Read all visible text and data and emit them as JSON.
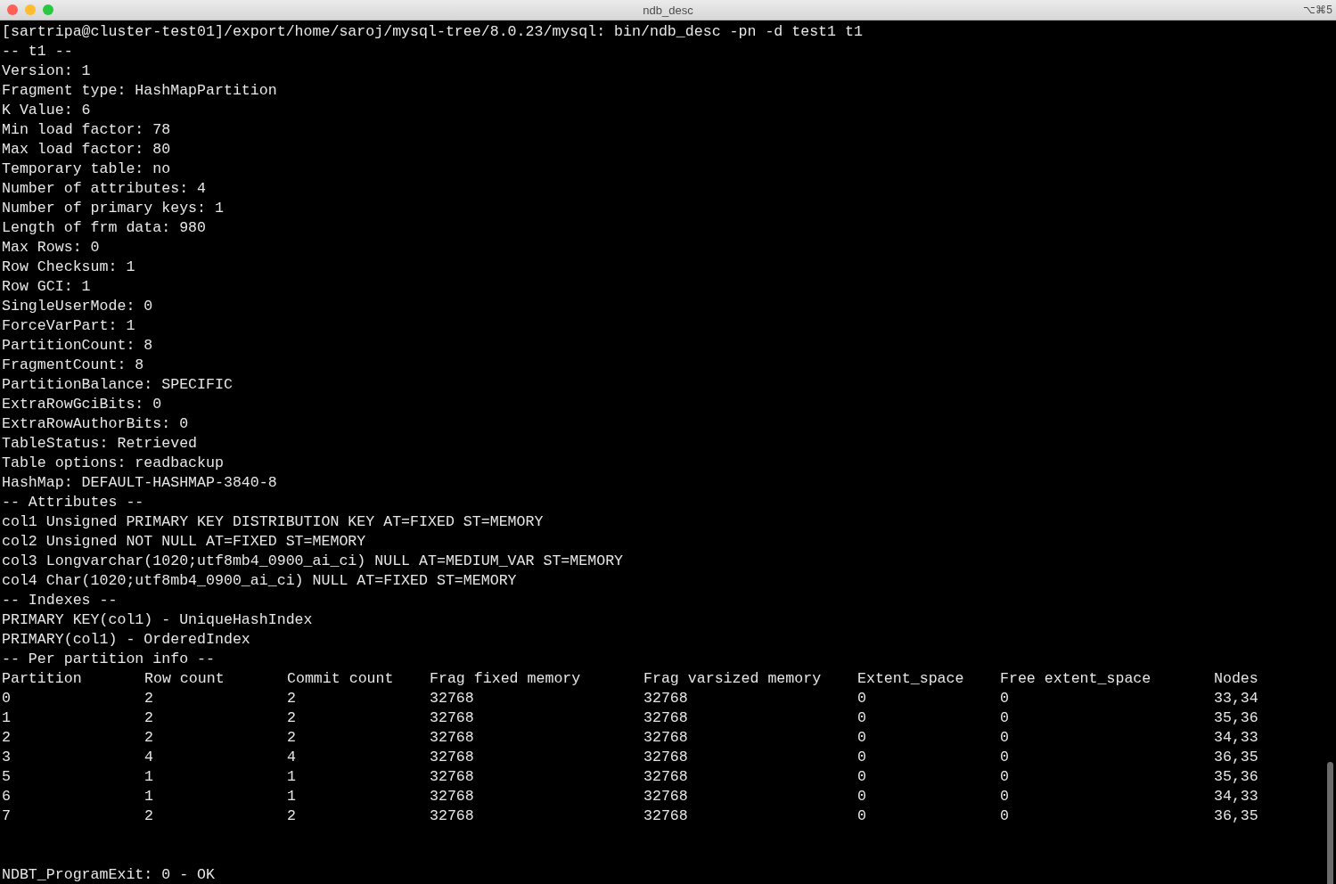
{
  "window": {
    "title": "ndb_desc",
    "shortcut": "⌥⌘5"
  },
  "output_lines": [
    "[sartripa@cluster-test01]/export/home/saroj/mysql-tree/8.0.23/mysql: bin/ndb_desc -pn -d test1 t1",
    "-- t1 --",
    "Version: 1",
    "Fragment type: HashMapPartition",
    "K Value: 6",
    "Min load factor: 78",
    "Max load factor: 80",
    "Temporary table: no",
    "Number of attributes: 4",
    "Number of primary keys: 1",
    "Length of frm data: 980",
    "Max Rows: 0",
    "Row Checksum: 1",
    "Row GCI: 1",
    "SingleUserMode: 0",
    "ForceVarPart: 1",
    "PartitionCount: 8",
    "FragmentCount: 8",
    "PartitionBalance: SPECIFIC",
    "ExtraRowGciBits: 0",
    "ExtraRowAuthorBits: 0",
    "TableStatus: Retrieved",
    "Table options: readbackup",
    "HashMap: DEFAULT-HASHMAP-3840-8",
    "-- Attributes --",
    "col1 Unsigned PRIMARY KEY DISTRIBUTION KEY AT=FIXED ST=MEMORY",
    "col2 Unsigned NOT NULL AT=FIXED ST=MEMORY",
    "col3 Longvarchar(1020;utf8mb4_0900_ai_ci) NULL AT=MEDIUM_VAR ST=MEMORY",
    "col4 Char(1020;utf8mb4_0900_ai_ci) NULL AT=FIXED ST=MEMORY",
    "-- Indexes --",
    "PRIMARY KEY(col1) - UniqueHashIndex",
    "PRIMARY(col1) - OrderedIndex",
    "-- Per partition info --"
  ],
  "partition_table": {
    "columns": [
      "Partition",
      "Row count",
      "Commit count",
      "Frag fixed memory",
      "Frag varsized memory",
      "Extent_space",
      "Free extent_space",
      "Nodes"
    ],
    "rows": [
      [
        "0",
        "2",
        "2",
        "32768",
        "32768",
        "0",
        "0",
        "33,34"
      ],
      [
        "1",
        "2",
        "2",
        "32768",
        "32768",
        "0",
        "0",
        "35,36"
      ],
      [
        "2",
        "2",
        "2",
        "32768",
        "32768",
        "0",
        "0",
        "34,33"
      ],
      [
        "3",
        "4",
        "4",
        "32768",
        "32768",
        "0",
        "0",
        "36,35"
      ],
      [
        "5",
        "1",
        "1",
        "32768",
        "32768",
        "0",
        "0",
        "35,36"
      ],
      [
        "6",
        "1",
        "1",
        "32768",
        "32768",
        "0",
        "0",
        "34,33"
      ],
      [
        "7",
        "2",
        "2",
        "32768",
        "32768",
        "0",
        "0",
        "36,35"
      ]
    ]
  },
  "exit_line": "NDBT_ProgramExit: 0 - OK"
}
